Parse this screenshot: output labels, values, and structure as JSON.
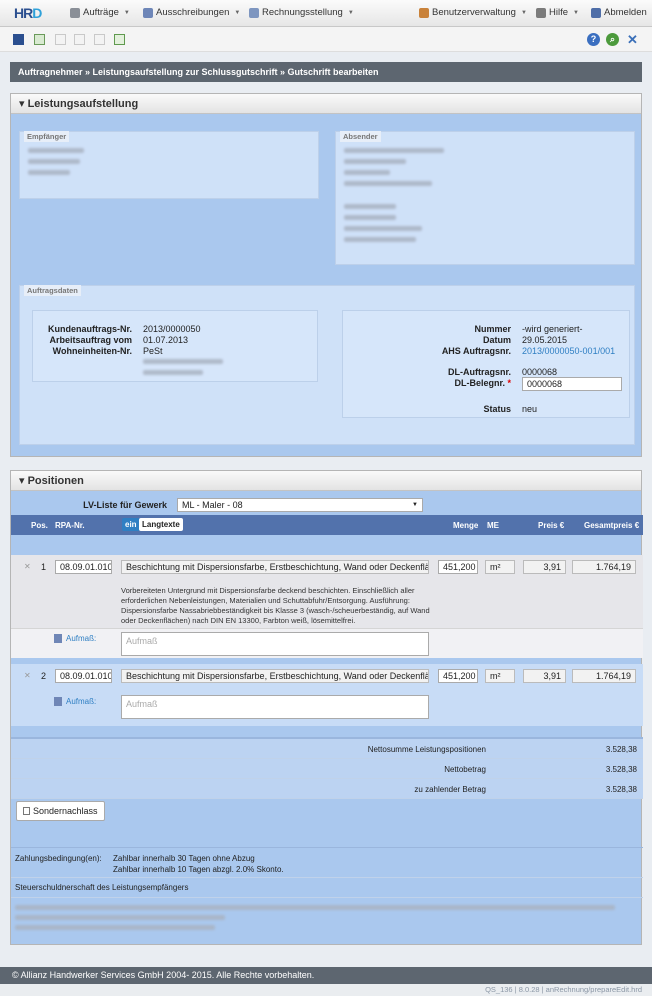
{
  "app": {
    "logo_part1": "HR",
    "logo_part2": "D"
  },
  "nav": {
    "auftraege": "Aufträge",
    "ausschreibungen": "Ausschreibungen",
    "rechnungsstellung": "Rechnungsstellung",
    "benutzerverwaltung": "Benutzerverwaltung",
    "hilfe": "Hilfe",
    "abmelden": "Abmelden"
  },
  "breadcrumb": "Auftragnehmer » Leistungsaufstellung zur Schlussgutschrift » Gutschrift bearbeiten",
  "leistung": {
    "title": "Leistungsaufstellung",
    "empfaenger_legend": "Empfänger",
    "absender_legend": "Absender",
    "auftragsdaten_legend": "Auftragsdaten",
    "kundenauftrag_label": "Kundenauftrags-Nr.",
    "kundenauftrag_value": "2013/0000050",
    "arbeitsauftrag_label": "Arbeitsauftrag vom",
    "arbeitsauftrag_value": "01.07.2013",
    "wohneinheiten_label": "Wohneinheiten-Nr.",
    "wohneinheiten_value": "PeSt",
    "nummer_label": "Nummer",
    "nummer_value": "-wird generiert-",
    "datum_label": "Datum",
    "datum_value": "29.05.2015",
    "ahs_label": "AHS Auftragsnr.",
    "ahs_value": "2013/0000050-001/001",
    "dl_auftrag_label": "DL-Auftragsnr.",
    "dl_auftrag_value": "0000068",
    "dl_beleg_label": "DL-Belegnr.",
    "required_mark": "*",
    "dl_beleg_value": "0000068",
    "status_label": "Status",
    "status_value": "neu"
  },
  "positionen": {
    "title": "Positionen",
    "lv_label": "LV-Liste für Gewerk",
    "lv_value": "ML - Maler - 08",
    "headers": {
      "pos": "Pos.",
      "rpa": "RPA-Nr.",
      "toggle_ein": "ein",
      "toggle_langtexte": "Langtexte",
      "menge": "Menge",
      "me": "ME",
      "preis": "Preis €",
      "gesamtpreis": "Gesamtpreis €"
    },
    "rows": [
      {
        "pos": "1",
        "rpa": "08.09.01.010",
        "text": "Beschichtung mit Dispersionsfarbe, Erstbeschichtung, Wand oder Deckenfläche",
        "menge": "451,200",
        "me": "m²",
        "preis": "3,91",
        "gesamt": "1.764,19",
        "langtext": "Vorbereiteten Untergrund mit Dispersionsfarbe deckend beschichten. Einschließlich aller erforderlichen Nebenleistungen, Materialien und Schuttabfuhr/Entsorgung. Ausführung: Dispersionsfarbe Nassabriebbeständigkeit bis Klasse 3 (wasch-/scheuerbeständig, auf Wand oder Deckenflächen) nach DIN EN 13300, Farbton weiß, lösemittelfrei.",
        "aufmass_label": "Aufmaß:",
        "aufmass_placeholder": "Aufmaß"
      },
      {
        "pos": "2",
        "rpa": "08.09.01.010",
        "text": "Beschichtung mit Dispersionsfarbe, Erstbeschichtung, Wand oder Deckenfläche",
        "menge": "451,200",
        "me": "m²",
        "preis": "3,91",
        "gesamt": "1.764,19",
        "aufmass_label": "Aufmaß:",
        "aufmass_placeholder": "Aufmaß"
      }
    ],
    "netto_positionen_label": "Nettosumme Leistungspositionen",
    "netto_positionen_value": "3.528,38",
    "nettobetrag_label": "Nettobetrag",
    "nettobetrag_value": "3.528,38",
    "zahlbetrag_label": "zu zahlender Betrag",
    "zahlbetrag_value": "3.528,38",
    "sondernachlass_button": "Sondernachlass",
    "zahlungsbedingung_label": "Zahlungsbedingung(en):",
    "zahlungsbedingung_line1": "Zahlbar innerhalb 30 Tagen ohne Abzug",
    "zahlungsbedingung_line2": "Zahlbar innerhalb 10 Tagen abzgl. 2.0% Skonto.",
    "steuerschuld": "Steuerschuldnerschaft des Leistungsempfängers"
  },
  "footer": {
    "copyright": "© Allianz Handwerker Services GmbH 2004- 2015. Alle Rechte vorbehalten.",
    "status": "QS_136 | 8.0.28 | anRechnung/prepareEdit.hrd"
  },
  "colors": {
    "accent": "#5272ac",
    "panel_bg": "#aac8ee",
    "dark_bar": "#5d6670",
    "link": "#2f7fc3"
  }
}
